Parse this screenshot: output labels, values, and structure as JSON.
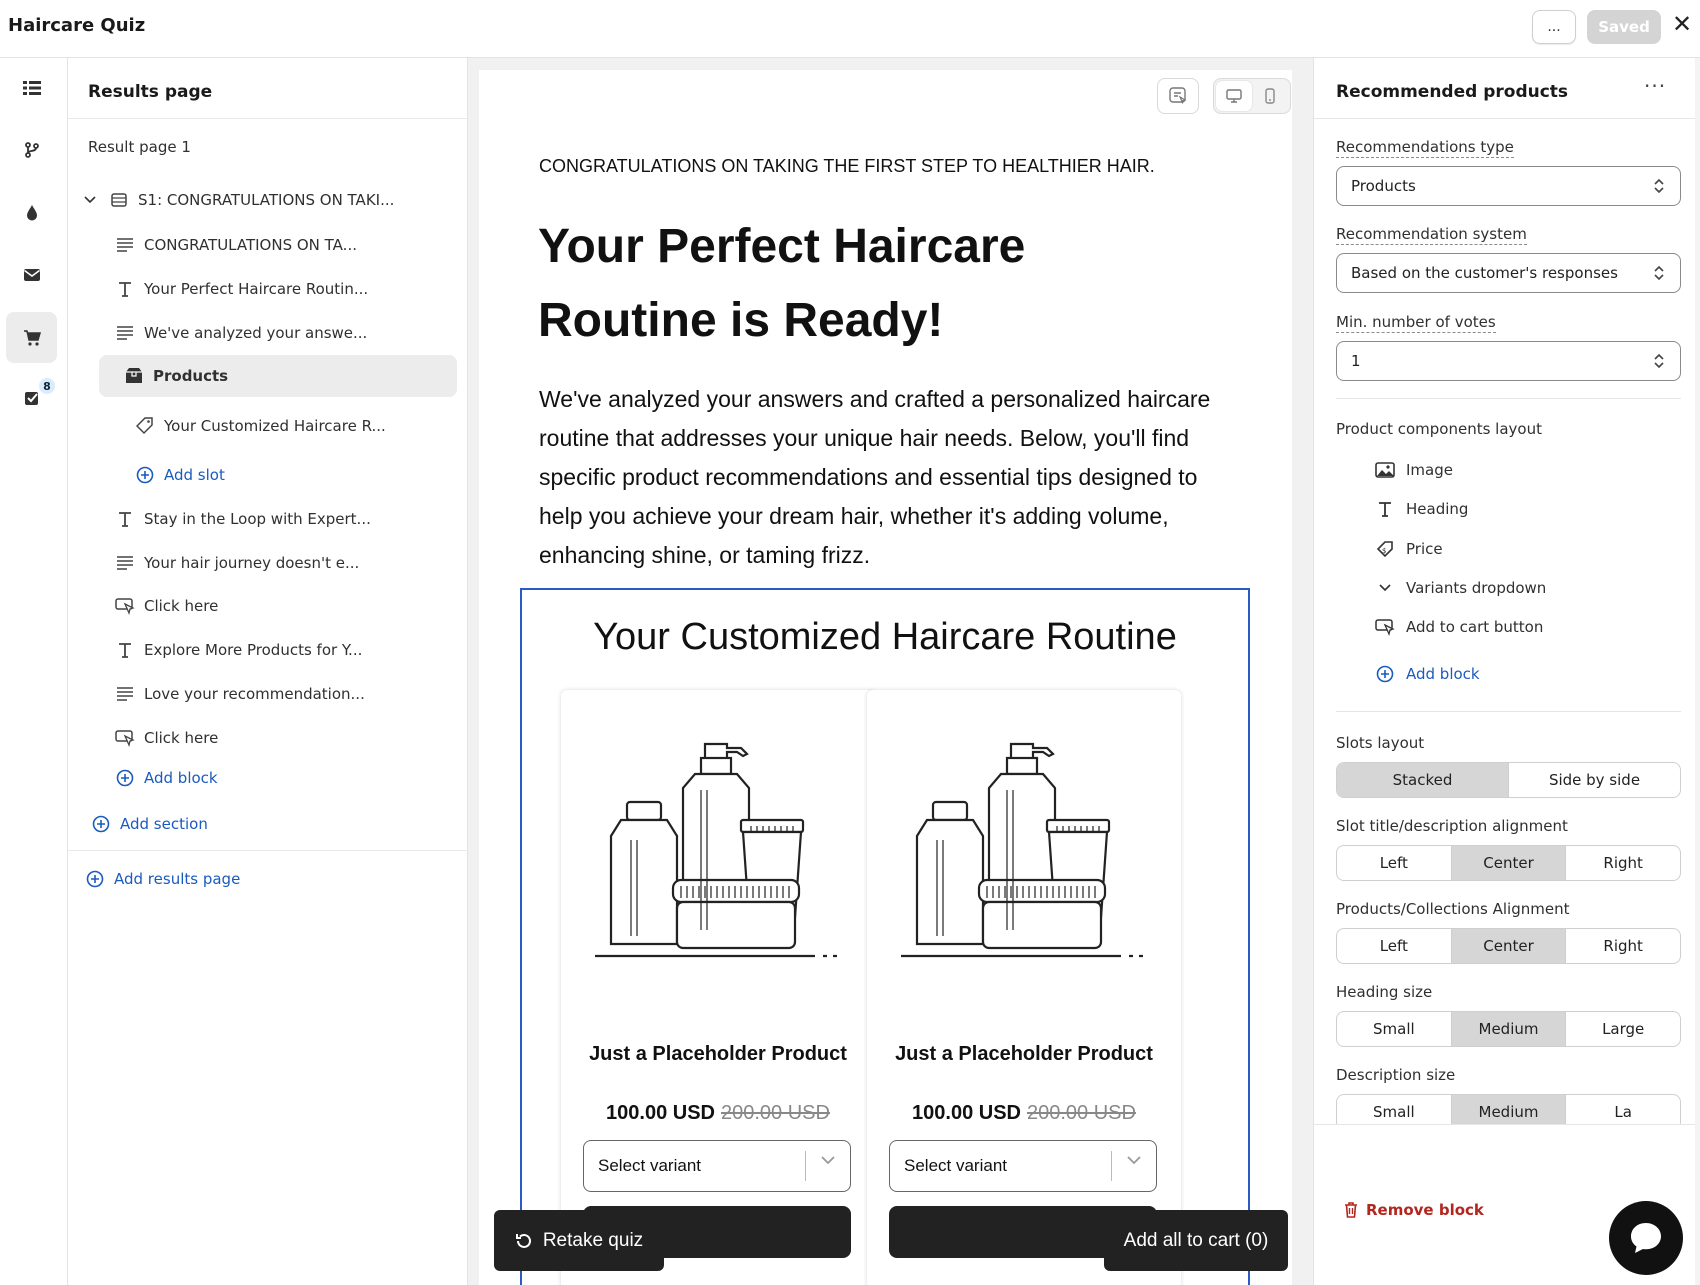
{
  "app": {
    "title": "Haircare Quiz",
    "more_label": "...",
    "saved_label": "Saved",
    "close_label": "✕"
  },
  "rail": {
    "badge": "8",
    "items": [
      "list-icon",
      "branch-icon",
      "drop-icon",
      "mail-icon",
      "cart-icon",
      "check-icon"
    ]
  },
  "tree": {
    "title": "Results page",
    "page_label": "Result page 1",
    "section_label": "S1: CONGRATULATIONS ON TAKI...",
    "items": [
      {
        "label": "CONGRATULATIONS ON TA...",
        "icon": "paragraph-icon"
      },
      {
        "label": "Your Perfect Haircare Routin...",
        "icon": "heading-icon"
      },
      {
        "label": "We've analyzed your answe...",
        "icon": "paragraph-icon"
      },
      {
        "label": "Products",
        "icon": "products-icon"
      },
      {
        "label": "Your Customized Haircare R...",
        "icon": "tag-icon"
      },
      {
        "label": "Add slot",
        "icon": "plus-circle-icon"
      },
      {
        "label": "Stay in the Loop with Expert...",
        "icon": "heading-icon"
      },
      {
        "label": "Your hair journey doesn't e...",
        "icon": "paragraph-icon"
      },
      {
        "label": "Click here",
        "icon": "button-icon"
      },
      {
        "label": "Explore More Products for Y...",
        "icon": "heading-icon"
      },
      {
        "label": "Love your recommendation...",
        "icon": "paragraph-icon"
      },
      {
        "label": "Click here",
        "icon": "button-icon"
      },
      {
        "label": "Add block",
        "icon": "plus-circle-icon"
      }
    ],
    "add_section": "Add section",
    "add_results_page": "Add results page"
  },
  "preview": {
    "kicker": "CONGRATULATIONS ON TAKING THE FIRST STEP TO HEALTHIER HAIR.",
    "headline": "Your Perfect Haircare Routine is Ready!",
    "intro": "We've analyzed your answers and crafted a personalized haircare routine that addresses your unique hair needs. Below, you'll find specific product recommendations and essential tips designed to help you achieve your dream hair, whether it's adding volume, enhancing shine, or taming frizz.",
    "rec_title": "Your Customized Haircare Routine",
    "cards": [
      {
        "name": "Just a Placeholder Product",
        "price": "100.00 USD",
        "old_price": "200.00 USD",
        "select": "Select variant"
      },
      {
        "name": "Just a Placeholder Product",
        "price": "100.00 USD",
        "old_price": "200.00 USD",
        "select": "Select variant"
      }
    ],
    "retake_label": "Retake quiz",
    "add_all_label": "Add all to cart (0)"
  },
  "settings": {
    "title": "Recommended products",
    "more": "···",
    "rec_type_label": "Recommendations type",
    "rec_type_value": "Products",
    "rec_system_label": "Recommendation system",
    "rec_system_value": "Based on the customer's responses",
    "min_votes_label": "Min. number of votes",
    "min_votes_value": "1",
    "components_label": "Product components layout",
    "components": [
      {
        "label": "Image",
        "icon": "image-icon"
      },
      {
        "label": "Heading",
        "icon": "heading-icon"
      },
      {
        "label": "Price",
        "icon": "price-tag-icon"
      },
      {
        "label": "Variants dropdown",
        "icon": "chevron-down-icon"
      },
      {
        "label": "Add to cart button",
        "icon": "button-icon"
      }
    ],
    "add_block": "Add block",
    "slots_layout_label": "Slots layout",
    "slots_layout_options": [
      "Stacked",
      "Side by side"
    ],
    "slot_align_label": "Slot title/description alignment",
    "align_options": [
      "Left",
      "Center",
      "Right"
    ],
    "products_align_label": "Products/Collections Alignment",
    "heading_size_label": "Heading size",
    "size_options": [
      "Small",
      "Medium",
      "Large"
    ],
    "description_size_label": "Description size",
    "description_size_visible": [
      "Small",
      "Medium",
      "La"
    ],
    "remove_block": "Remove block"
  }
}
